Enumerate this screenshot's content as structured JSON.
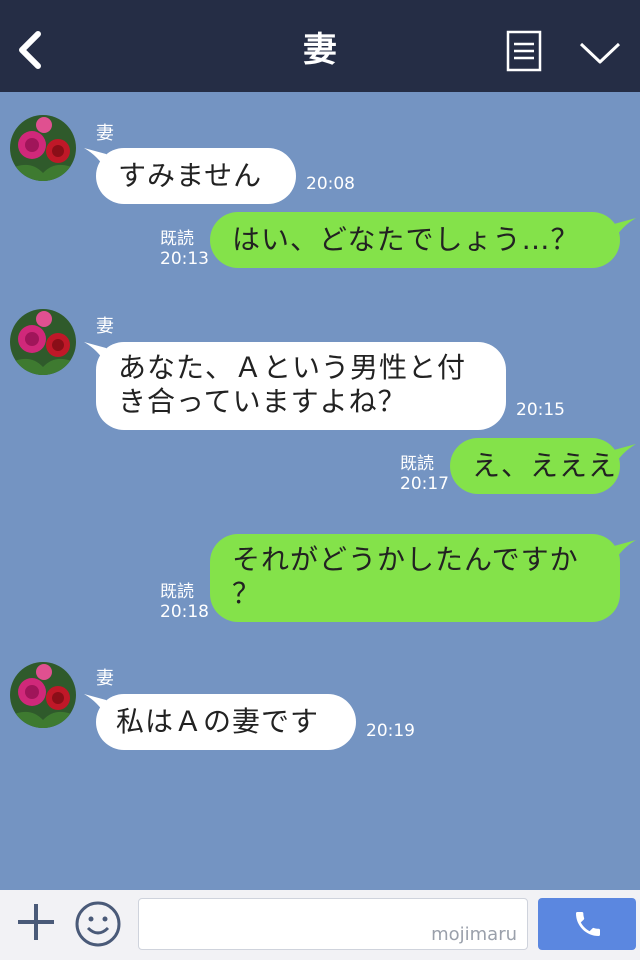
{
  "header": {
    "title": "妻"
  },
  "contact": {
    "name": "妻"
  },
  "messages": [
    {
      "id": "m1",
      "text": "すみません",
      "time": "20:08",
      "dir": "in"
    },
    {
      "id": "m2",
      "text": "はい、どなたでしょう…？",
      "read": "既読",
      "time": "20:13",
      "dir": "out"
    },
    {
      "id": "m3",
      "lines": [
        "あなた、Ａという男性と付",
        "き合っていますよね？"
      ],
      "time": "20:15",
      "dir": "in"
    },
    {
      "id": "m4",
      "text": "え、えええ",
      "read": "既読",
      "time": "20:17",
      "dir": "out"
    },
    {
      "id": "m5",
      "lines": [
        "それがどうかしたんですか",
        "？"
      ],
      "read": "既読",
      "time": "20:18",
      "dir": "out"
    },
    {
      "id": "m6",
      "text": "私はＡの妻です",
      "time": "20:19",
      "dir": "in"
    }
  ],
  "footer": {
    "watermark": "mojimaru"
  },
  "icons": [
    "back-chevron-icon",
    "menu-icon",
    "chevron-down-icon",
    "plus-icon",
    "emoji-icon",
    "phone-icon",
    "avatar-rose-icon"
  ],
  "colors": {
    "header_bg": "#252d45",
    "chat_bg": "#7494c2",
    "bubble_in": "#ffffff",
    "bubble_out": "#84e24a",
    "call_button": "#5b87e0"
  }
}
